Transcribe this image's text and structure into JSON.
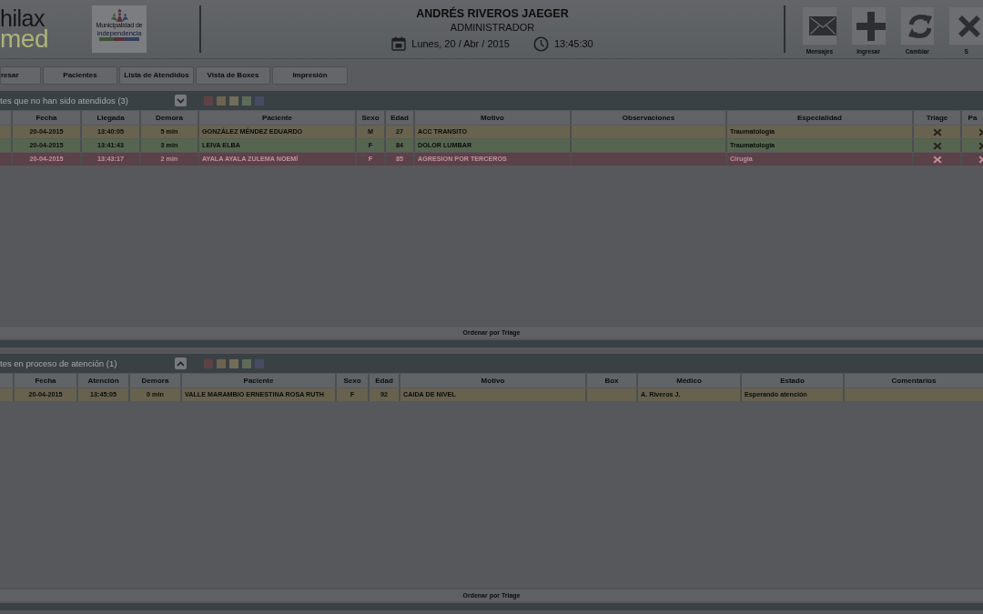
{
  "header": {
    "app_logo": {
      "line_1": "hilax",
      "line_2": "med"
    },
    "municipality_logo": {
      "line_1": "Municipalidad de",
      "line_2": "independencia"
    },
    "user_name": "ANDRÉS RIVEROS JAEGER",
    "user_role": "ADMINISTRADOR",
    "date": "Lunes, 20 / Abr / 2015",
    "time": "13:45:30",
    "actions": [
      {
        "kind": "mail",
        "label": "Mensajes"
      },
      {
        "kind": "plus",
        "label": "Ingresar"
      },
      {
        "kind": "refresh",
        "label": "Cambiar"
      },
      {
        "kind": "close",
        "label": "S"
      }
    ]
  },
  "nav_tabs": [
    {
      "label": "resar"
    },
    {
      "label": "Pacientes"
    },
    {
      "label": "Lista de Atendidos"
    },
    {
      "label": "Vista de Boxes"
    },
    {
      "label": "Impresión"
    }
  ],
  "sections": [
    {
      "title": "tes que no han sido atendidos (3)",
      "pointing_up": false,
      "legend": [
        {
          "color": "#5e4147"
        },
        {
          "color": "#6c6351"
        },
        {
          "color": "#716d5b"
        },
        {
          "color": "#5d6c59"
        },
        {
          "color": "#474b64"
        }
      ],
      "columns": [
        {
          "kind": "blank"
        },
        {
          "kind": "centered",
          "label": "Fecha"
        },
        {
          "kind": "centered",
          "label": "Llegada"
        },
        {
          "kind": "centered",
          "label": "Demora"
        },
        {
          "kind": "text",
          "label": "Paciente"
        },
        {
          "kind": "centered",
          "label": "Sexo"
        },
        {
          "kind": "centered",
          "label": "Edad"
        },
        {
          "kind": "text",
          "label": "Motivo"
        },
        {
          "kind": "text",
          "label": "Observaciones"
        },
        {
          "kind": "text",
          "label": "Especialidad"
        },
        {
          "kind": "icon",
          "label": "Triage"
        },
        {
          "kind": "partial",
          "label": "Pa"
        }
      ],
      "rows": [
        {
          "color": "#67634f",
          "cells": [
            "",
            "20-04-2015",
            "13:40:05",
            "5 min",
            "GONZÁLEZ MÉNDEZ EDUARDO",
            "M",
            "27",
            "ACC TRANSITO",
            "",
            "Traumatología",
            "",
            ""
          ]
        },
        {
          "color": "#56654f",
          "cells": [
            "",
            "20-04-2015",
            "13:41:43",
            "3 min",
            "LEIVA ELBA",
            "F",
            "84",
            "DOLOR LUMBAR",
            "",
            "Traumatología",
            "",
            ""
          ]
        },
        {
          "color": "#5b4148",
          "cells": [
            "",
            "20-04-2015",
            "13:43:17",
            "2 min",
            "AYALA AYALA ZULEMA NOEMÍ",
            "F",
            "85",
            "AGRESION POR TERCEROS",
            "",
            "Cirugía",
            "",
            ""
          ]
        }
      ],
      "footer": "Ordenar por Triage"
    },
    {
      "title": "tes en proceso de atención (1)",
      "pointing_up": true,
      "legend": [
        {
          "color": "#5e4147"
        },
        {
          "color": "#6c6351"
        },
        {
          "color": "#716d5b"
        },
        {
          "color": "#5d6c59"
        },
        {
          "color": "#474b64"
        }
      ],
      "columns": [
        {
          "kind": "blank"
        },
        {
          "kind": "centered",
          "label": "Fecha"
        },
        {
          "kind": "centered",
          "label": "Atención"
        },
        {
          "kind": "centered",
          "label": "Demora"
        },
        {
          "kind": "text",
          "label": "Paciente"
        },
        {
          "kind": "centered",
          "label": "Sexo"
        },
        {
          "kind": "centered",
          "label": "Edad"
        },
        {
          "kind": "text",
          "label": "Motivo"
        },
        {
          "kind": "text",
          "label": "Box"
        },
        {
          "kind": "text",
          "label": "Médico"
        },
        {
          "kind": "text",
          "label": "Estado"
        },
        {
          "kind": "text",
          "label": "Comentarios"
        }
      ],
      "rows": [
        {
          "color": "#66624e",
          "cells": [
            "",
            "20-04-2015",
            "13:45:05",
            "0 min",
            "VALLE MARAMBIO ERNESTINA ROSA RUTH",
            "F",
            "92",
            "CAIDA DE NIVEL",
            "",
            "A. Riveros J.",
            "Esperando atención",
            ""
          ]
        }
      ],
      "footer": "Ordenar por Triage"
    }
  ]
}
